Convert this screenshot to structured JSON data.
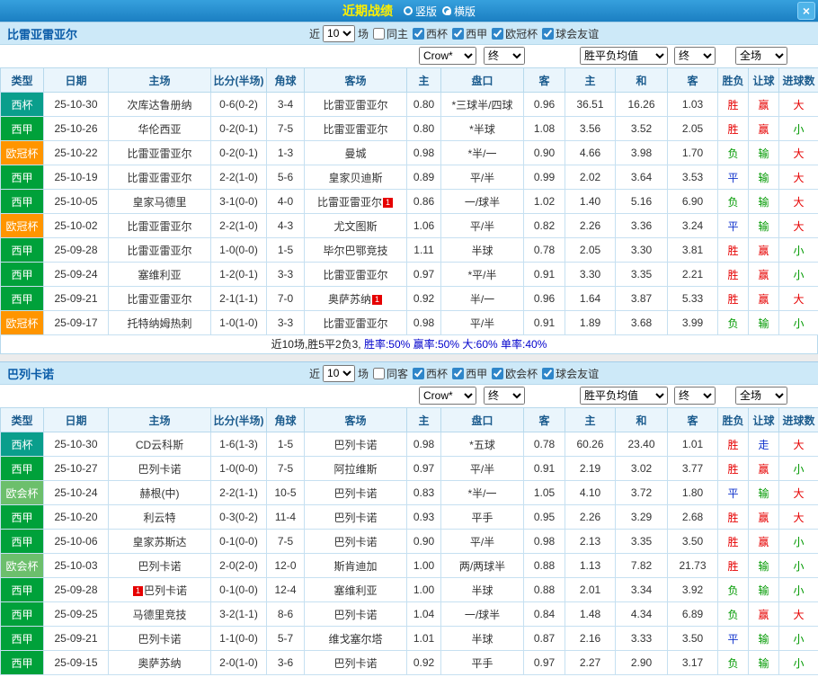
{
  "topbar": {
    "title": "近期战绩",
    "layout_options": [
      {
        "label": "竖版",
        "selected": false
      },
      {
        "label": "横版",
        "selected": true
      }
    ],
    "close_label": "×"
  },
  "filter": {
    "near": "近",
    "count": "10",
    "games": "场"
  },
  "dropdowns": {
    "company": "Crow*",
    "final_1": "终",
    "avg": "胜平负均值",
    "final_2": "终",
    "scope": "全场"
  },
  "table_headers": [
    "类型",
    "日期",
    "主场",
    "比分(半场)",
    "角球",
    "客场",
    "主",
    "盘口",
    "客",
    "主",
    "和",
    "客",
    "胜负",
    "让球",
    "进球数"
  ],
  "type_colors": {
    "西杯": "#0a9e8c",
    "西甲": "#00a13a",
    "欧冠杯": "#ff9500",
    "欧会杯": "#6cbf6c"
  },
  "result_colors": {
    "win": "#e60000",
    "lose": "#009900",
    "draw": "#1133cc"
  },
  "sections": [
    {
      "team": "比雷亚雷亚尔",
      "checkboxes": [
        {
          "label": "同主",
          "checked": false
        },
        {
          "label": "西杯",
          "checked": true
        },
        {
          "label": "西甲",
          "checked": true
        },
        {
          "label": "欧冠杯",
          "checked": true
        },
        {
          "label": "球会友谊",
          "checked": true
        }
      ],
      "rows": [
        {
          "type": "西杯",
          "date": "25-10-30",
          "home": "次库达鲁册纳",
          "home_focus": false,
          "score": "0-6(0-2)",
          "corners": "3-4",
          "away": "比雷亚雷亚尔",
          "away_focus": true,
          "ah_home": "0.80",
          "handicap": "*三球半/四球",
          "handicap_red": true,
          "ah_away": "0.96",
          "eu_home": "36.51",
          "eu_draw": "16.26",
          "eu_away": "1.03",
          "result": "胜",
          "result_c": "win",
          "cover": "赢",
          "cover_c": "win",
          "goals": "大",
          "goals_c": "win"
        },
        {
          "type": "西甲",
          "date": "25-10-26",
          "home": "华伦西亚",
          "home_focus": false,
          "score": "0-2(0-1)",
          "corners": "7-5",
          "away": "比雷亚雷亚尔",
          "away_focus": true,
          "ah_home": "0.80",
          "handicap": "*半球",
          "handicap_red": true,
          "ah_away": "1.08",
          "eu_home": "3.56",
          "eu_draw": "3.52",
          "eu_away": "2.05",
          "result": "胜",
          "result_c": "win",
          "cover": "赢",
          "cover_c": "win",
          "goals": "小",
          "goals_c": "lose"
        },
        {
          "type": "欧冠杯",
          "date": "25-10-22",
          "home": "比雷亚雷亚尔",
          "home_focus": true,
          "score": "0-2(0-1)",
          "corners": "1-3",
          "away": "曼城",
          "away_focus": false,
          "ah_home": "0.98",
          "handicap": "*半/一",
          "handicap_red": true,
          "ah_away": "0.90",
          "eu_home": "4.66",
          "eu_draw": "3.98",
          "eu_away": "1.70",
          "result": "负",
          "result_c": "lose",
          "cover": "输",
          "cover_c": "lose",
          "goals": "大",
          "goals_c": "win"
        },
        {
          "type": "西甲",
          "date": "25-10-19",
          "home": "比雷亚雷亚尔",
          "home_focus": true,
          "score": "2-2(1-0)",
          "corners": "5-6",
          "away": "皇家贝迪斯",
          "away_focus": false,
          "ah_home": "0.89",
          "handicap": "平/半",
          "handicap_red": false,
          "ah_away": "0.99",
          "eu_home": "2.02",
          "eu_draw": "3.64",
          "eu_away": "3.53",
          "result": "平",
          "result_c": "draw",
          "cover": "输",
          "cover_c": "lose",
          "goals": "大",
          "goals_c": "win"
        },
        {
          "type": "西甲",
          "date": "25-10-05",
          "home": "皇家马德里",
          "home_focus": false,
          "score": "3-1(0-0)",
          "corners": "4-0",
          "away": "比雷亚雷亚尔",
          "away_focus": true,
          "away_badge": "1",
          "away_badge_pos": "after",
          "ah_home": "0.86",
          "handicap": "一/球半",
          "handicap_red": false,
          "ah_away": "1.02",
          "eu_home": "1.40",
          "eu_draw": "5.16",
          "eu_away": "6.90",
          "result": "负",
          "result_c": "lose",
          "cover": "输",
          "cover_c": "lose",
          "goals": "大",
          "goals_c": "win"
        },
        {
          "type": "欧冠杯",
          "date": "25-10-02",
          "home": "比雷亚雷亚尔",
          "home_focus": true,
          "score": "2-2(1-0)",
          "corners": "4-3",
          "away": "尤文图斯",
          "away_focus": false,
          "ah_home": "1.06",
          "handicap": "平/半",
          "handicap_red": false,
          "ah_away": "0.82",
          "eu_home": "2.26",
          "eu_draw": "3.36",
          "eu_away": "3.24",
          "result": "平",
          "result_c": "draw",
          "cover": "输",
          "cover_c": "lose",
          "goals": "大",
          "goals_c": "win"
        },
        {
          "type": "西甲",
          "date": "25-09-28",
          "home": "比雷亚雷亚尔",
          "home_focus": true,
          "score": "1-0(0-0)",
          "corners": "1-5",
          "away": "毕尔巴鄂竞技",
          "away_focus": false,
          "ah_home": "1.11",
          "handicap": "半球",
          "handicap_red": false,
          "ah_away": "0.78",
          "eu_home": "2.05",
          "eu_draw": "3.30",
          "eu_away": "3.81",
          "result": "胜",
          "result_c": "win",
          "cover": "赢",
          "cover_c": "win",
          "goals": "小",
          "goals_c": "lose"
        },
        {
          "type": "西甲",
          "date": "25-09-24",
          "home": "塞维利亚",
          "home_focus": false,
          "score": "1-2(0-1)",
          "corners": "3-3",
          "away": "比雷亚雷亚尔",
          "away_focus": true,
          "ah_home": "0.97",
          "handicap": "*平/半",
          "handicap_red": true,
          "ah_away": "0.91",
          "eu_home": "3.30",
          "eu_draw": "3.35",
          "eu_away": "2.21",
          "result": "胜",
          "result_c": "win",
          "cover": "赢",
          "cover_c": "win",
          "goals": "小",
          "goals_c": "lose"
        },
        {
          "type": "西甲",
          "date": "25-09-21",
          "home": "比雷亚雷亚尔",
          "home_focus": true,
          "score": "2-1(1-1)",
          "corners": "7-0",
          "away": "奥萨苏纳",
          "away_focus": false,
          "away_badge": "1",
          "away_badge_pos": "after",
          "ah_home": "0.92",
          "handicap": "半/一",
          "handicap_red": false,
          "ah_away": "0.96",
          "eu_home": "1.64",
          "eu_draw": "3.87",
          "eu_away": "5.33",
          "result": "胜",
          "result_c": "win",
          "cover": "赢",
          "cover_c": "win",
          "goals": "大",
          "goals_c": "win"
        },
        {
          "type": "欧冠杯",
          "date": "25-09-17",
          "home": "托特纳姆热刺",
          "home_focus": false,
          "score": "1-0(1-0)",
          "corners": "3-3",
          "away": "比雷亚雷亚尔",
          "away_focus": true,
          "ah_home": "0.98",
          "handicap": "平/半",
          "handicap_red": false,
          "ah_away": "0.91",
          "eu_home": "1.89",
          "eu_draw": "3.68",
          "eu_away": "3.99",
          "result": "负",
          "result_c": "lose",
          "cover": "输",
          "cover_c": "lose",
          "goals": "小",
          "goals_c": "lose"
        }
      ],
      "summary": [
        {
          "text": "近10场,胜5平2负3, ",
          "color": "#222222"
        },
        {
          "text": "胜率:50% ",
          "color": "#0000cc"
        },
        {
          "text": "赢率:50% ",
          "color": "#0000cc"
        },
        {
          "text": "大:60% ",
          "color": "#0000cc"
        },
        {
          "text": "单率:40%",
          "color": "#0000cc"
        }
      ]
    },
    {
      "team": "巴列卡诺",
      "checkboxes": [
        {
          "label": "同客",
          "checked": false
        },
        {
          "label": "西杯",
          "checked": true
        },
        {
          "label": "西甲",
          "checked": true
        },
        {
          "label": "欧会杯",
          "checked": true
        },
        {
          "label": "球会友谊",
          "checked": true
        }
      ],
      "rows": [
        {
          "type": "西杯",
          "date": "25-10-30",
          "home": "CD云科斯",
          "home_focus": false,
          "score": "1-6(1-3)",
          "corners": "1-5",
          "away": "巴列卡诺",
          "away_focus": true,
          "ah_home": "0.98",
          "handicap": "*五球",
          "handicap_red": true,
          "ah_away": "0.78",
          "eu_home": "60.26",
          "eu_draw": "23.40",
          "eu_away": "1.01",
          "result": "胜",
          "result_c": "win",
          "cover": "走",
          "cover_c": "draw",
          "goals": "大",
          "goals_c": "win"
        },
        {
          "type": "西甲",
          "date": "25-10-27",
          "home": "巴列卡诺",
          "home_focus": true,
          "score": "1-0(0-0)",
          "corners": "7-5",
          "away": "阿拉维斯",
          "away_focus": false,
          "ah_home": "0.97",
          "handicap": "平/半",
          "handicap_red": false,
          "ah_away": "0.91",
          "eu_home": "2.19",
          "eu_draw": "3.02",
          "eu_away": "3.77",
          "result": "胜",
          "result_c": "win",
          "cover": "赢",
          "cover_c": "win",
          "goals": "小",
          "goals_c": "lose"
        },
        {
          "type": "欧会杯",
          "date": "25-10-24",
          "home": "赫根(中)",
          "home_focus": false,
          "score": "2-2(1-1)",
          "corners": "10-5",
          "away": "巴列卡诺",
          "away_focus": true,
          "ah_home": "0.83",
          "handicap": "*半/一",
          "handicap_red": true,
          "ah_away": "1.05",
          "eu_home": "4.10",
          "eu_draw": "3.72",
          "eu_away": "1.80",
          "result": "平",
          "result_c": "draw",
          "cover": "输",
          "cover_c": "lose",
          "goals": "大",
          "goals_c": "win"
        },
        {
          "type": "西甲",
          "date": "25-10-20",
          "home": "利云特",
          "home_focus": false,
          "score": "0-3(0-2)",
          "corners": "11-4",
          "away": "巴列卡诺",
          "away_focus": true,
          "ah_home": "0.93",
          "handicap": "平手",
          "handicap_red": false,
          "ah_away": "0.95",
          "eu_home": "2.26",
          "eu_draw": "3.29",
          "eu_away": "2.68",
          "result": "胜",
          "result_c": "win",
          "cover": "赢",
          "cover_c": "win",
          "goals": "大",
          "goals_c": "win"
        },
        {
          "type": "西甲",
          "date": "25-10-06",
          "home": "皇家苏斯达",
          "home_focus": false,
          "score": "0-1(0-0)",
          "corners": "7-5",
          "away": "巴列卡诺",
          "away_focus": true,
          "ah_home": "0.90",
          "handicap": "平/半",
          "handicap_red": false,
          "ah_away": "0.98",
          "eu_home": "2.13",
          "eu_draw": "3.35",
          "eu_away": "3.50",
          "result": "胜",
          "result_c": "win",
          "cover": "赢",
          "cover_c": "win",
          "goals": "小",
          "goals_c": "lose"
        },
        {
          "type": "欧会杯",
          "date": "25-10-03",
          "home": "巴列卡诺",
          "home_focus": true,
          "score": "2-0(2-0)",
          "corners": "12-0",
          "away": "斯肯迪加",
          "away_focus": false,
          "ah_home": "1.00",
          "handicap": "两/两球半",
          "handicap_red": false,
          "ah_away": "0.88",
          "eu_home": "1.13",
          "eu_draw": "7.82",
          "eu_away": "21.73",
          "result": "胜",
          "result_c": "win",
          "cover": "输",
          "cover_c": "lose",
          "goals": "小",
          "goals_c": "lose"
        },
        {
          "type": "西甲",
          "date": "25-09-28",
          "home": "巴列卡诺",
          "home_focus": true,
          "home_badge": "1",
          "home_badge_pos": "before",
          "score": "0-1(0-0)",
          "corners": "12-4",
          "away": "塞维利亚",
          "away_focus": false,
          "ah_home": "1.00",
          "handicap": "半球",
          "handicap_red": false,
          "ah_away": "0.88",
          "eu_home": "2.01",
          "eu_draw": "3.34",
          "eu_away": "3.92",
          "result": "负",
          "result_c": "lose",
          "cover": "输",
          "cover_c": "lose",
          "goals": "小",
          "goals_c": "lose"
        },
        {
          "type": "西甲",
          "date": "25-09-25",
          "home": "马德里竞技",
          "home_focus": false,
          "score": "3-2(1-1)",
          "corners": "8-6",
          "away": "巴列卡诺",
          "away_focus": true,
          "ah_home": "1.04",
          "handicap": "一/球半",
          "handicap_red": false,
          "ah_away": "0.84",
          "eu_home": "1.48",
          "eu_draw": "4.34",
          "eu_away": "6.89",
          "result": "负",
          "result_c": "lose",
          "cover": "赢",
          "cover_c": "win",
          "goals": "大",
          "goals_c": "win"
        },
        {
          "type": "西甲",
          "date": "25-09-21",
          "home": "巴列卡诺",
          "home_focus": true,
          "score": "1-1(0-0)",
          "corners": "5-7",
          "away": "维戈塞尔塔",
          "away_focus": false,
          "ah_home": "1.01",
          "handicap": "半球",
          "handicap_red": false,
          "ah_away": "0.87",
          "eu_home": "2.16",
          "eu_draw": "3.33",
          "eu_away": "3.50",
          "result": "平",
          "result_c": "draw",
          "cover": "输",
          "cover_c": "lose",
          "goals": "小",
          "goals_c": "lose"
        },
        {
          "type": "西甲",
          "date": "25-09-15",
          "home": "奥萨苏纳",
          "home_focus": false,
          "score": "2-0(1-0)",
          "corners": "3-6",
          "away": "巴列卡诺",
          "away_focus": true,
          "ah_home": "0.92",
          "handicap": "平手",
          "handicap_red": false,
          "ah_away": "0.97",
          "eu_home": "2.27",
          "eu_draw": "2.90",
          "eu_away": "3.17",
          "result": "负",
          "result_c": "lose",
          "cover": "输",
          "cover_c": "lose",
          "goals": "小",
          "goals_c": "lose"
        }
      ],
      "summary": []
    }
  ]
}
